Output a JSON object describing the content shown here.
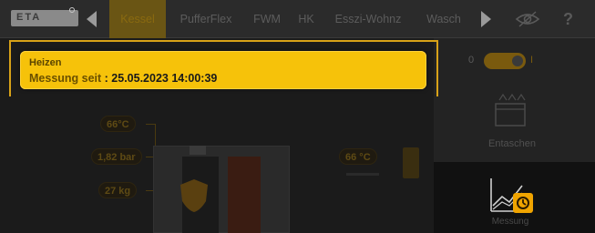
{
  "header": {
    "logo_text": "ETA",
    "tabs": [
      {
        "label": "Kessel",
        "active": true
      },
      {
        "label": "PufferFlex",
        "active": false
      },
      {
        "label": "FWM",
        "active": false
      },
      {
        "label": "HK",
        "active": false
      },
      {
        "label": "Esszi-Wohnz",
        "active": false
      },
      {
        "label": "Wasch",
        "active": false
      }
    ],
    "help_label": "?",
    "icons": {
      "prev": "triangle-left-icon",
      "next": "triangle-right-icon",
      "view": "eye-icon"
    }
  },
  "banner": {
    "line1": "Heizen",
    "line2_prefix": "Messung seit ",
    "line2_value": ": 25.05.2023 14:00:39"
  },
  "readings": {
    "temp_top": "66°C",
    "pressure": "1,82 bar",
    "weight": "27 kg",
    "temp_right": "66 °C"
  },
  "side_panel": {
    "toggle_off": "0",
    "toggle_on": "I",
    "toggle_state": "on",
    "entaschen_label": "Entaschen",
    "messung_label": "Messung"
  },
  "colors": {
    "accent": "#f6c20a",
    "frame": "#d8a218",
    "background": "#1b1b1b"
  }
}
